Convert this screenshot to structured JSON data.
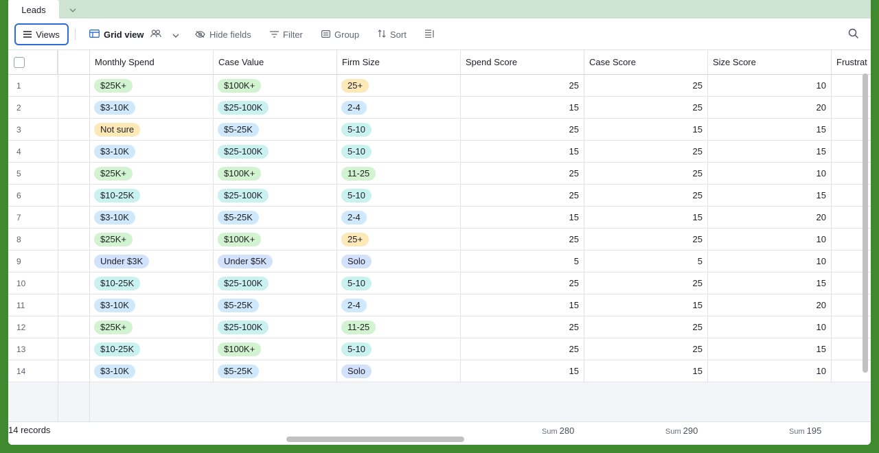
{
  "tabs": {
    "active": "Leads"
  },
  "toolbar": {
    "views_label": "Views",
    "grid_view_label": "Grid view",
    "hide_fields_label": "Hide fields",
    "filter_label": "Filter",
    "group_label": "Group",
    "sort_label": "Sort"
  },
  "columns": [
    "Monthly Spend",
    "Case Value",
    "Firm Size",
    "Spend Score",
    "Case Score",
    "Size Score",
    "Frustrat"
  ],
  "colors": {
    "green": "#d1f3d0",
    "blue": "#cfe8fb",
    "yellow": "#fde9b8",
    "teal": "#c9f1ef",
    "indigo": "#d2e1fc",
    "accent": "#2d6bd8",
    "border_green": "#3f8a2e"
  },
  "rows": [
    {
      "n": "1",
      "spend": "$25K+",
      "spend_c": "green",
      "case": "$100K+",
      "case_c": "green",
      "size": "25+",
      "size_c": "yellow",
      "s1": "25",
      "s2": "25",
      "s3": "10"
    },
    {
      "n": "2",
      "spend": "$3-10K",
      "spend_c": "blue",
      "case": "$25-100K",
      "case_c": "teal",
      "size": "2-4",
      "size_c": "blue",
      "s1": "15",
      "s2": "25",
      "s3": "20"
    },
    {
      "n": "3",
      "spend": "Not sure",
      "spend_c": "yellow",
      "case": "$5-25K",
      "case_c": "blue",
      "size": "5-10",
      "size_c": "teal",
      "s1": "25",
      "s2": "15",
      "s3": "15"
    },
    {
      "n": "4",
      "spend": "$3-10K",
      "spend_c": "blue",
      "case": "$25-100K",
      "case_c": "teal",
      "size": "5-10",
      "size_c": "teal",
      "s1": "15",
      "s2": "25",
      "s3": "15"
    },
    {
      "n": "5",
      "spend": "$25K+",
      "spend_c": "green",
      "case": "$100K+",
      "case_c": "green",
      "size": "11-25",
      "size_c": "green",
      "s1": "25",
      "s2": "25",
      "s3": "10"
    },
    {
      "n": "6",
      "spend": "$10-25K",
      "spend_c": "teal",
      "case": "$25-100K",
      "case_c": "teal",
      "size": "5-10",
      "size_c": "teal",
      "s1": "25",
      "s2": "25",
      "s3": "15"
    },
    {
      "n": "7",
      "spend": "$3-10K",
      "spend_c": "blue",
      "case": "$5-25K",
      "case_c": "blue",
      "size": "2-4",
      "size_c": "blue",
      "s1": "15",
      "s2": "15",
      "s3": "20"
    },
    {
      "n": "8",
      "spend": "$25K+",
      "spend_c": "green",
      "case": "$100K+",
      "case_c": "green",
      "size": "25+",
      "size_c": "yellow",
      "s1": "25",
      "s2": "25",
      "s3": "10"
    },
    {
      "n": "9",
      "spend": "Under $3K",
      "spend_c": "indigo",
      "case": "Under $5K",
      "case_c": "indigo",
      "size": "Solo",
      "size_c": "indigo",
      "s1": "5",
      "s2": "5",
      "s3": "10"
    },
    {
      "n": "10",
      "spend": "$10-25K",
      "spend_c": "teal",
      "case": "$25-100K",
      "case_c": "teal",
      "size": "5-10",
      "size_c": "teal",
      "s1": "25",
      "s2": "25",
      "s3": "15"
    },
    {
      "n": "11",
      "spend": "$3-10K",
      "spend_c": "blue",
      "case": "$5-25K",
      "case_c": "blue",
      "size": "2-4",
      "size_c": "blue",
      "s1": "15",
      "s2": "15",
      "s3": "20"
    },
    {
      "n": "12",
      "spend": "$25K+",
      "spend_c": "green",
      "case": "$25-100K",
      "case_c": "teal",
      "size": "11-25",
      "size_c": "green",
      "s1": "25",
      "s2": "25",
      "s3": "10"
    },
    {
      "n": "13",
      "spend": "$10-25K",
      "spend_c": "teal",
      "case": "$100K+",
      "case_c": "green",
      "size": "5-10",
      "size_c": "teal",
      "s1": "25",
      "s2": "25",
      "s3": "15"
    },
    {
      "n": "14",
      "spend": "$3-10K",
      "spend_c": "blue",
      "case": "$5-25K",
      "case_c": "blue",
      "size": "Solo",
      "size_c": "indigo",
      "s1": "15",
      "s2": "15",
      "s3": "10"
    }
  ],
  "footer": {
    "records": "14 records",
    "sum_label": "Sum",
    "sum_spend": "280",
    "sum_case": "290",
    "sum_size": "195"
  }
}
